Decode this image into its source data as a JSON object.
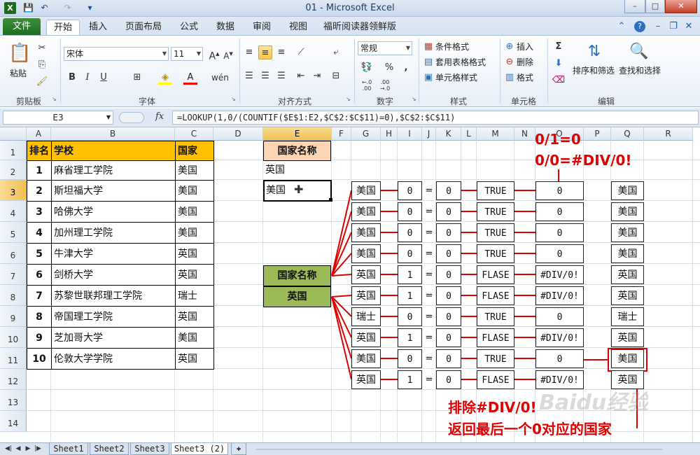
{
  "window": {
    "title": "01 - Microsoft Excel",
    "min": "–",
    "max": "□",
    "close": "✕"
  },
  "qat": [
    "💾",
    "↶",
    "↷",
    "▾"
  ],
  "tabs": {
    "file": "文件",
    "items": [
      "开始",
      "插入",
      "页面布局",
      "公式",
      "数据",
      "审阅",
      "视图",
      "福昕阅读器领鲜版"
    ]
  },
  "ribbon": {
    "clipboard": {
      "paste": "粘贴",
      "label": "剪贴板"
    },
    "font": {
      "name": "宋体",
      "size": "11",
      "label": "字体"
    },
    "align": {
      "label": "对齐方式"
    },
    "number": {
      "format": "常规",
      "label": "数字",
      "percent": "%",
      "comma": ",",
      "inc": "←.0\n.00",
      "dec": ".00\n→.0"
    },
    "styles": {
      "cond": "条件格式",
      "table": "套用表格格式",
      "cell": "单元格样式",
      "label": "样式"
    },
    "cells": {
      "insert": "插入",
      "delete": "删除",
      "format": "格式",
      "label": "单元格"
    },
    "editing": {
      "sort": "排序和筛选",
      "find": "查找和选择",
      "label": "编辑"
    }
  },
  "formula_bar": {
    "name_box": "E3",
    "fx": "fx",
    "formula": "=LOOKUP(1,0/(COUNTIF($E$1:E2,$C$2:$C$11)=0),$C$2:$C$11)"
  },
  "columns": [
    "A",
    "B",
    "C",
    "D",
    "E",
    "F",
    "G",
    "H",
    "I",
    "J",
    "K",
    "L",
    "M",
    "N",
    "O",
    "P",
    "Q",
    "R"
  ],
  "rows": [
    "1",
    "2",
    "3",
    "4",
    "5",
    "6",
    "7",
    "8",
    "9",
    "10",
    "11",
    "12",
    "13",
    "14"
  ],
  "table": {
    "headers": [
      "排名",
      "学校",
      "国家"
    ],
    "rows": [
      [
        "1",
        "麻省理工学院",
        "美国"
      ],
      [
        "2",
        "斯坦福大学",
        "美国"
      ],
      [
        "3",
        "哈佛大学",
        "美国"
      ],
      [
        "4",
        "加州理工学院",
        "美国"
      ],
      [
        "5",
        "牛津大学",
        "英国"
      ],
      [
        "6",
        "剑桥大学",
        "英国"
      ],
      [
        "7",
        "苏黎世联邦理工学院",
        "瑞士"
      ],
      [
        "8",
        "帝国理工学院",
        "英国"
      ],
      [
        "9",
        "芝加哥大学",
        "美国"
      ],
      [
        "10",
        "伦敦大学学院",
        "英国"
      ]
    ]
  },
  "e_column": {
    "header": "国家名称",
    "e2": "英国",
    "e3": "美国"
  },
  "green": {
    "title": "国家名称",
    "value": "英国"
  },
  "diagram": {
    "g": [
      "美国",
      "美国",
      "美国",
      "美国",
      "英国",
      "英国",
      "瑞士",
      "英国",
      "美国",
      "英国"
    ],
    "i": [
      "0",
      "0",
      "0",
      "0",
      "1",
      "1",
      "0",
      "1",
      "0",
      "1"
    ],
    "eq": "=",
    "k": [
      "0",
      "0",
      "0",
      "0",
      "0",
      "0",
      "0",
      "0",
      "0",
      "0"
    ],
    "m": [
      "TRUE",
      "TRUE",
      "TRUE",
      "TRUE",
      "FLASE",
      "FLASE",
      "TRUE",
      "FLASE",
      "TRUE",
      "FLASE"
    ],
    "o": [
      "0",
      "0",
      "0",
      "0",
      "#DIV/0!",
      "#DIV/0!",
      "0",
      "#DIV/0!",
      "0",
      "#DIV/0!"
    ],
    "q": [
      "美国",
      "美国",
      "美国",
      "美国",
      "英国",
      "英国",
      "瑞士",
      "英国",
      "美国",
      "英国"
    ]
  },
  "annotations": {
    "line1": "0/1=0",
    "line2": "0/0=#DIV/0!",
    "bottom1": "排除#DIV/0!",
    "bottom2": "返回最后一个0对应的国家"
  },
  "sheets": [
    "Sheet1",
    "Sheet2",
    "Sheet3",
    "Sheet3 (2)"
  ],
  "watermark": "Baidu经验",
  "colors": {
    "header_fill": "#ffc000",
    "e1_fill": "#fcd5b4",
    "green_fill": "#9bbb59",
    "red": "#e00000",
    "excel_green": "#1e6b1e"
  }
}
